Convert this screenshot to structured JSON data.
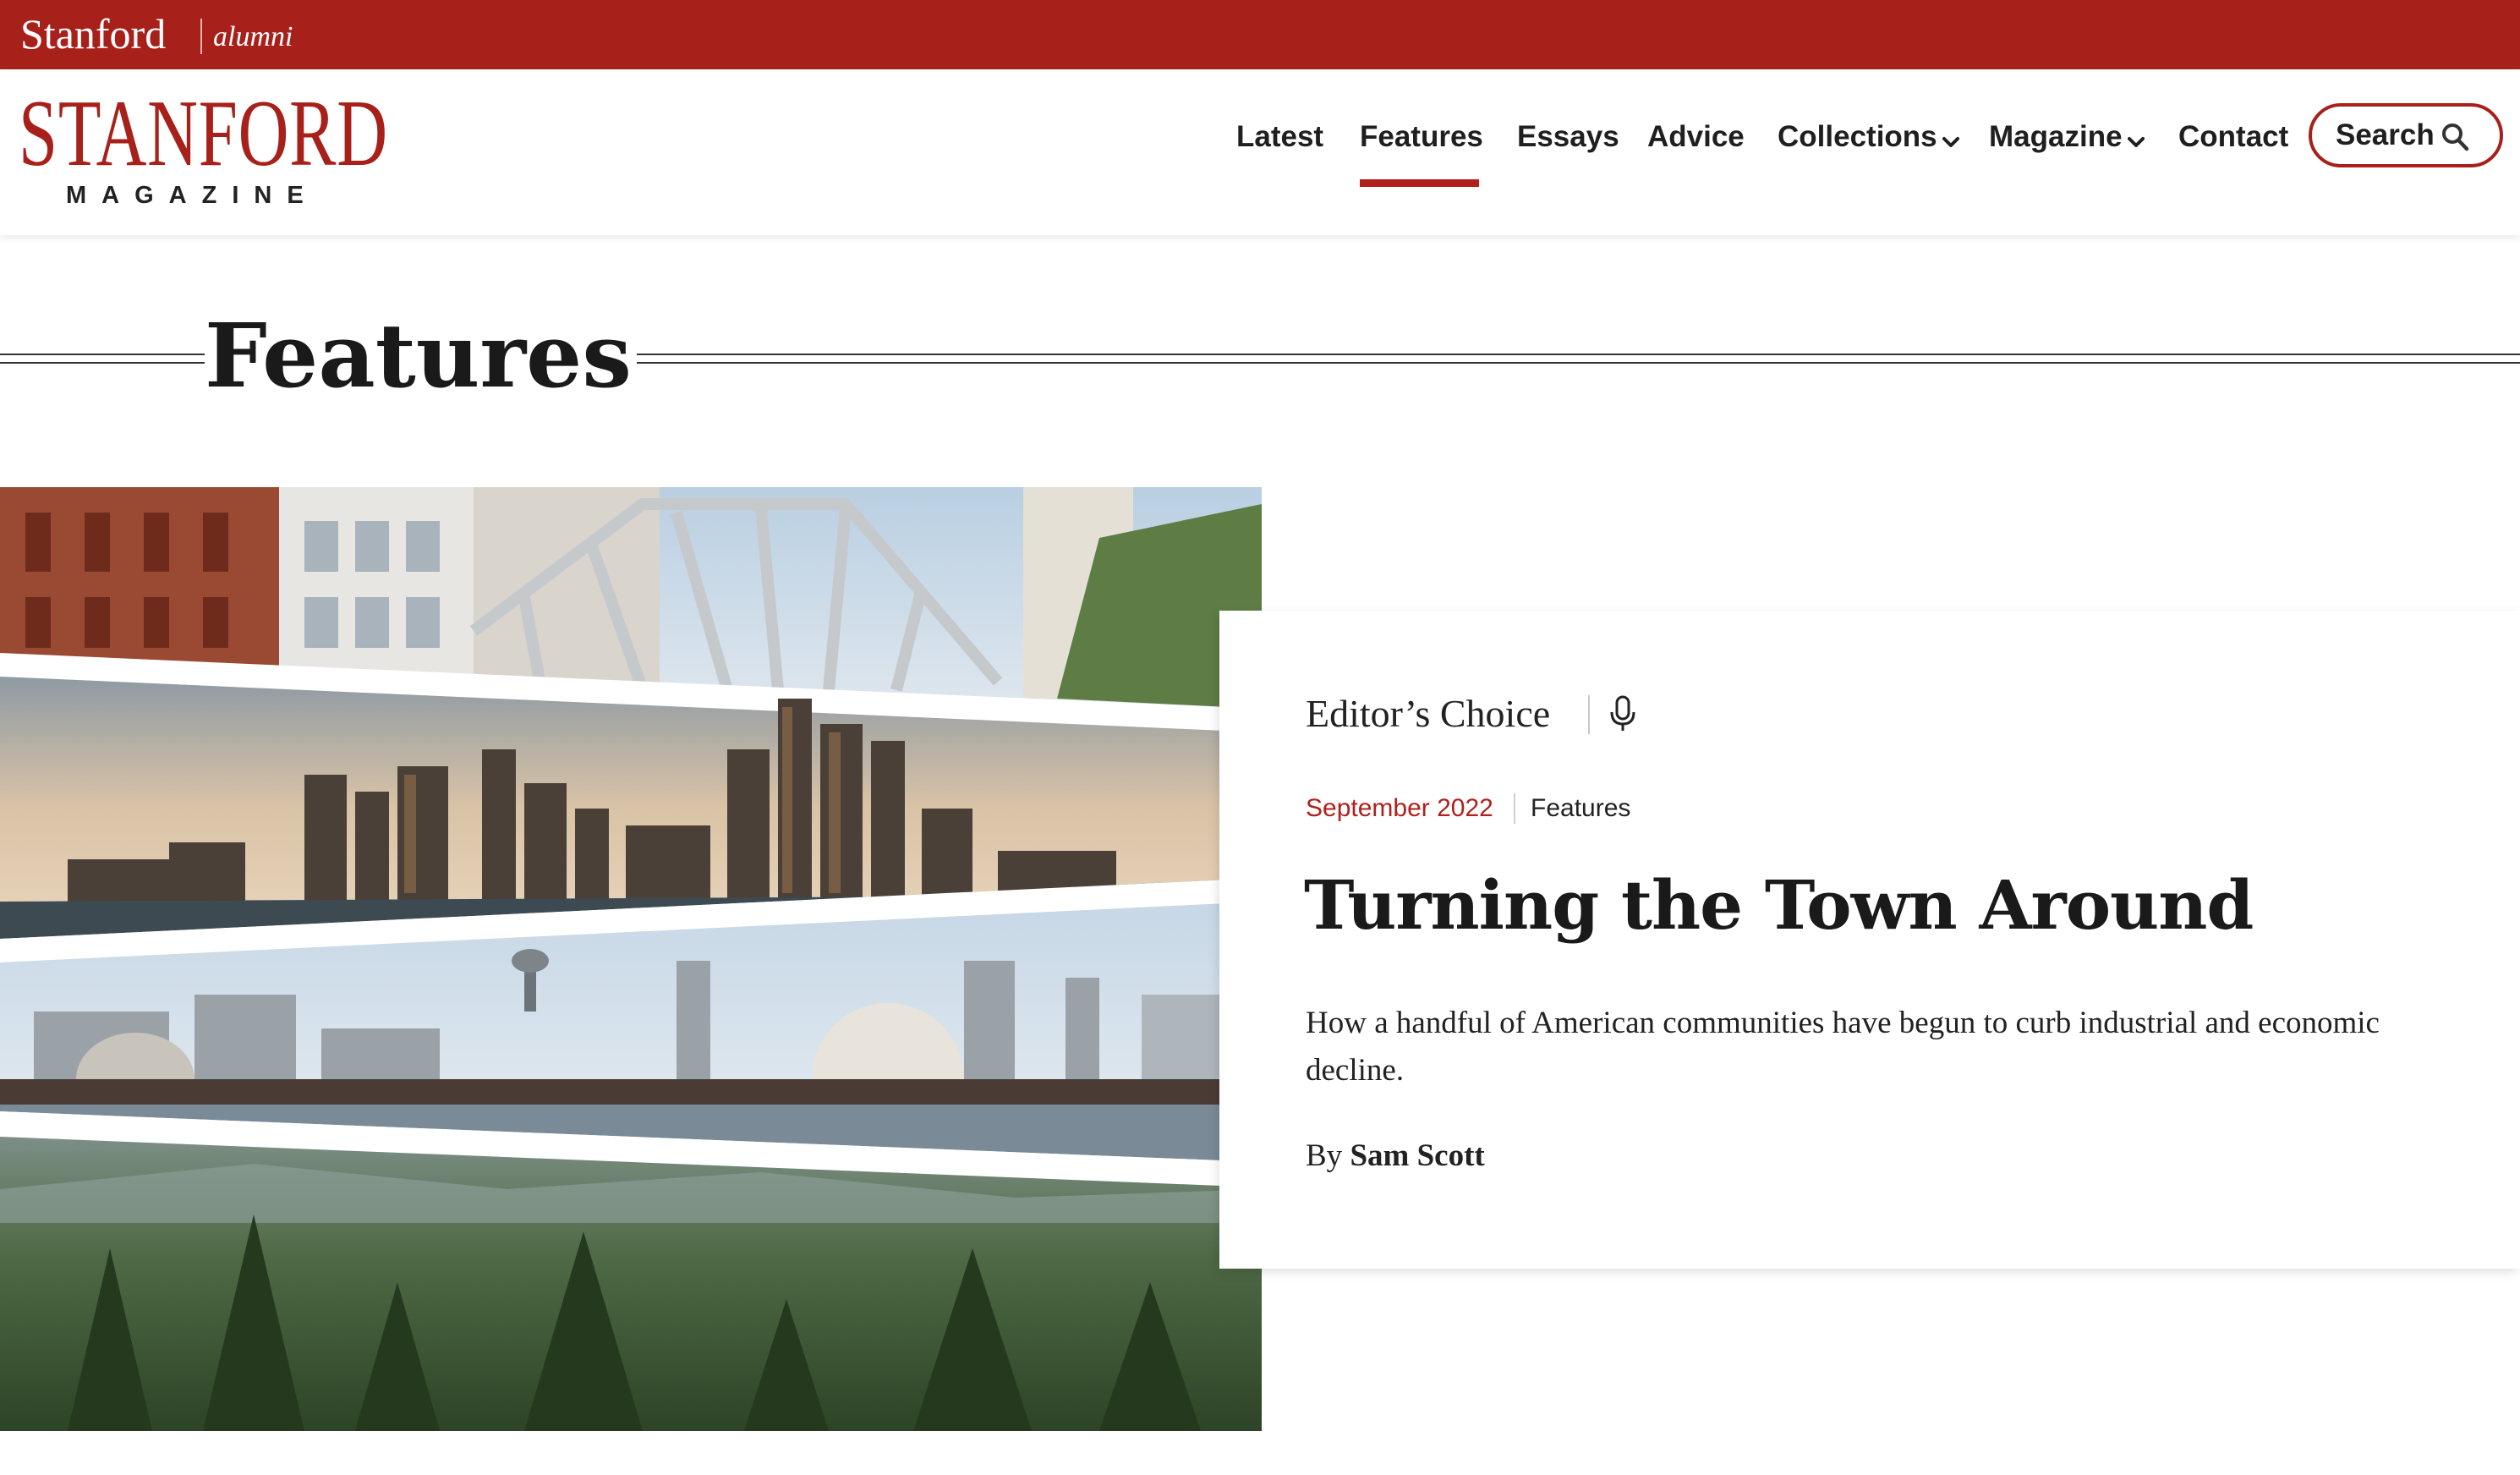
{
  "alumni_bar": {
    "brand": "Stanford",
    "sub": "alumni"
  },
  "logo": {
    "main": "STANFORD",
    "sub": "MAGAZINE"
  },
  "nav": {
    "items": [
      {
        "label": "Latest"
      },
      {
        "label": "Features",
        "active": true
      },
      {
        "label": "Essays"
      },
      {
        "label": "Advice"
      },
      {
        "label": "Collections",
        "has_dropdown": true
      },
      {
        "label": "Magazine",
        "has_dropdown": true
      },
      {
        "label": "Contact"
      }
    ],
    "search_label": "Search"
  },
  "page": {
    "title": "Features"
  },
  "feature": {
    "badge": "Editor’s Choice",
    "badge_icon": "microphone-icon",
    "date": "September 2022",
    "section": "Features",
    "title": "Turning the Town Around",
    "dek": "How a handful of American communities have begun to curb industrial and economic decline.",
    "byline_prefix": "By",
    "author": "Sam Scott"
  },
  "colors": {
    "brand_red": "#a8201a",
    "text": "#1a1a1a",
    "background": "#ffffff"
  }
}
